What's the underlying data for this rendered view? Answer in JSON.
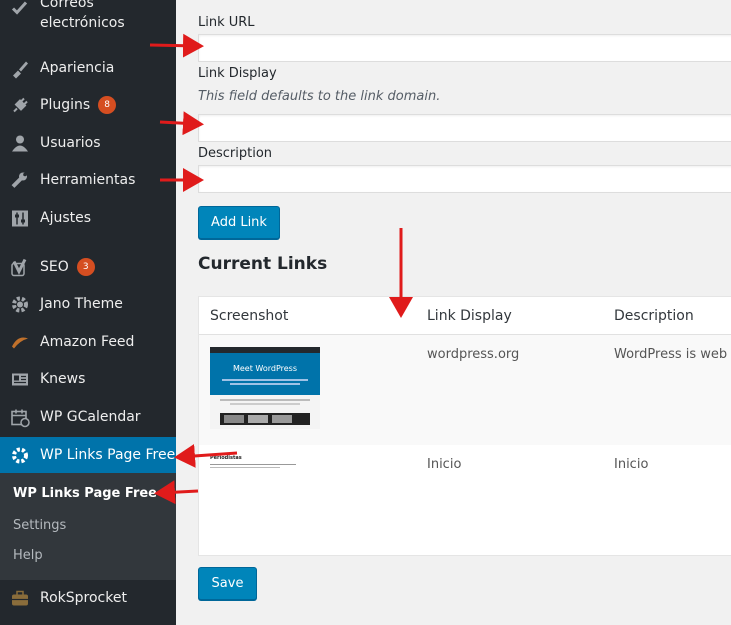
{
  "sidebar": {
    "items": [
      {
        "label": "Correos electrónicos",
        "icon": "check-icon"
      },
      {
        "label": "Apariencia",
        "icon": "brush-icon"
      },
      {
        "label": "Plugins",
        "icon": "plugin-icon",
        "badge": "8"
      },
      {
        "label": "Usuarios",
        "icon": "user-icon"
      },
      {
        "label": "Herramientas",
        "icon": "wrench-icon"
      },
      {
        "label": "Ajustes",
        "icon": "settings-sliders-icon"
      },
      {
        "label": "SEO",
        "icon": "yoast-icon",
        "badge": "3"
      },
      {
        "label": "Jano Theme",
        "icon": "gear-icon"
      },
      {
        "label": "Amazon Feed",
        "icon": "feather-icon"
      },
      {
        "label": "Knews",
        "icon": "newspaper-icon"
      },
      {
        "label": "WP GCalendar",
        "icon": "calendar-icon"
      },
      {
        "label": "WP Links Page Free",
        "icon": "gear-icon"
      },
      {
        "label": "RokSprocket",
        "icon": "toolbox-icon"
      }
    ],
    "submenu": [
      "WP Links Page Free",
      "Settings",
      "Help"
    ]
  },
  "form": {
    "link_url_label": "Link URL",
    "link_url_value": "",
    "link_display_label": "Link Display",
    "link_display_hint": "This field defaults to the link domain.",
    "link_display_value": "",
    "description_label": "Description",
    "description_value": "",
    "add_button": "Add Link"
  },
  "current_links": {
    "title": "Current Links",
    "columns": [
      "Screenshot",
      "Link Display",
      "Description"
    ],
    "rows": [
      {
        "display": "wordpress.org",
        "description": "WordPress is web",
        "thumb_text": "Meet WordPress"
      },
      {
        "display": "Inicio",
        "description": "Inicio",
        "thumb_text": "Periodistas"
      }
    ]
  },
  "save_button": "Save",
  "colors": {
    "sidebar": "#23282d",
    "accent": "#0073aa",
    "button": "#0085ba",
    "arrow": "#e01b1b",
    "badge": "#d54e21"
  }
}
